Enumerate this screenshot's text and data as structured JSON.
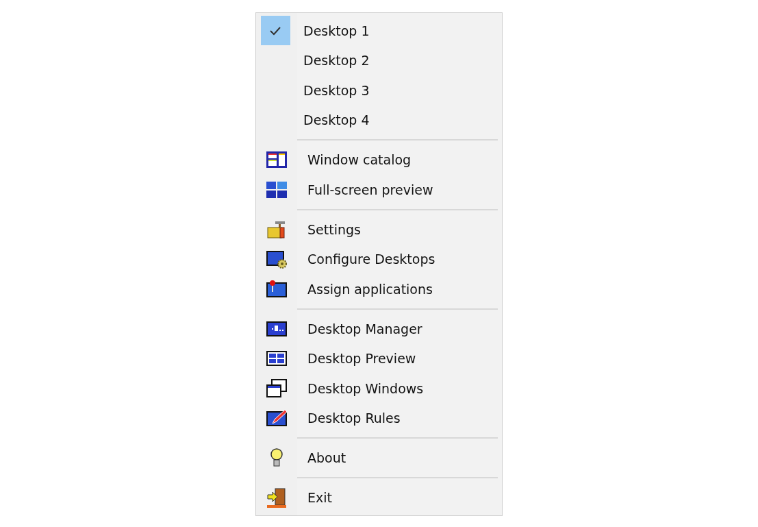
{
  "menu": {
    "groups": [
      {
        "items": [
          {
            "kind": "desktop",
            "label": "Desktop 1",
            "selected": true
          },
          {
            "kind": "desktop",
            "label": "Desktop 2",
            "selected": false
          },
          {
            "kind": "desktop",
            "label": "Desktop 3",
            "selected": false
          },
          {
            "kind": "desktop",
            "label": "Desktop 4",
            "selected": false
          }
        ]
      },
      {
        "items": [
          {
            "kind": "command",
            "label": "Window catalog"
          },
          {
            "kind": "command",
            "label": "Full-screen preview"
          }
        ]
      },
      {
        "items": [
          {
            "kind": "command",
            "label": "Settings"
          },
          {
            "kind": "command",
            "label": "Configure Desktops"
          },
          {
            "kind": "command",
            "label": "Assign applications"
          }
        ]
      },
      {
        "items": [
          {
            "kind": "command",
            "label": "Desktop Manager"
          },
          {
            "kind": "command",
            "label": "Desktop Preview"
          },
          {
            "kind": "command",
            "label": "Desktop Windows"
          },
          {
            "kind": "command",
            "label": "Desktop Rules"
          }
        ]
      },
      {
        "items": [
          {
            "kind": "command",
            "label": "About"
          }
        ]
      },
      {
        "items": [
          {
            "kind": "command",
            "label": "Exit"
          }
        ]
      }
    ]
  }
}
